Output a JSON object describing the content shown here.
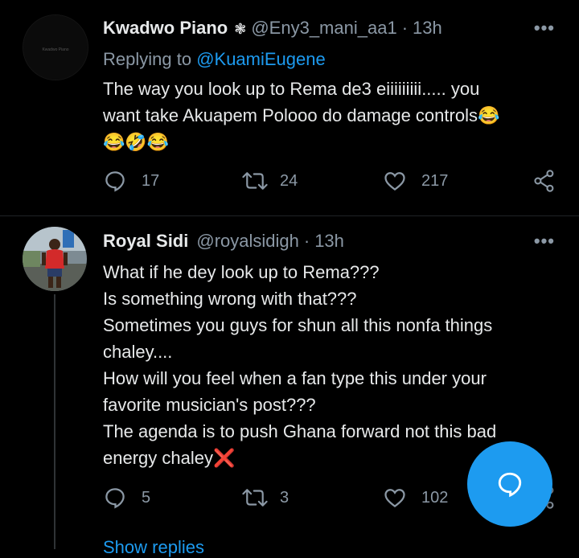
{
  "tweet1": {
    "name": "Kwadwo Piano",
    "verified_glyph": "❃",
    "handle": "@Eny3_mani_aa1",
    "time": "13h",
    "more": "•••",
    "replying_prefix": "Replying to ",
    "replying_mention": "@KuamiEugene",
    "lines": [
      "The way you look up to Rema de3 eiiiiiiiii..... you",
      "want take Akuapem Polooo do damage controls😂",
      "😂🤣😂"
    ],
    "reply_count": "17",
    "retweet_count": "24",
    "like_count": "217"
  },
  "tweet2": {
    "name": "Royal Sidi",
    "handle": "@royalsidigh",
    "time": "13h",
    "more": "•••",
    "lines": [
      "What if he dey look up to Rema???",
      "Is something wrong with that???",
      "Sometimes you guys for shun all this nonfa things",
      "chaley....",
      "How will you feel when a fan type this under your",
      "favorite musician's post???",
      "The agenda is to push Ghana forward not this bad",
      "energy chaley❌"
    ],
    "reply_count": "5",
    "retweet_count": "3",
    "like_count": "102"
  },
  "show_replies": "Show replies",
  "colors": {
    "accent": "#1d9bf0",
    "muted": "#8b98a5",
    "text": "#e7e9ea",
    "background": "#000000"
  },
  "icons": [
    "reply-icon",
    "retweet-icon",
    "like-icon",
    "share-icon",
    "more-icon",
    "compose-reply-icon",
    "verified-icon"
  ]
}
